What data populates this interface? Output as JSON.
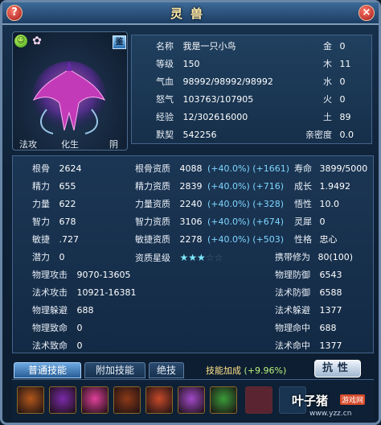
{
  "window": {
    "title": "灵兽",
    "help_label": "?",
    "close_label": "×"
  },
  "portrait": {
    "appraise_label": "鉴",
    "labels": [
      "法攻",
      "化生",
      "阴"
    ]
  },
  "identity": {
    "rows": [
      {
        "key": "名称",
        "value": "我是一只小鸟"
      },
      {
        "key": "等级",
        "value": "150"
      },
      {
        "key": "气血",
        "value": "98992/98992/98992"
      },
      {
        "key": "怒气",
        "value": "103763/107905"
      },
      {
        "key": "经验",
        "value": "12/302616000"
      },
      {
        "key": "默契",
        "value": "542256"
      }
    ],
    "elements": [
      {
        "key": "金",
        "value": "0"
      },
      {
        "key": "木",
        "value": "11"
      },
      {
        "key": "水",
        "value": "0"
      },
      {
        "key": "火",
        "value": "0"
      },
      {
        "key": "土",
        "value": "89"
      },
      {
        "key": "亲密度",
        "value": "0.0"
      }
    ]
  },
  "attributes": {
    "base": [
      {
        "key": "根骨",
        "value": "2624"
      },
      {
        "key": "精力",
        "value": "655"
      },
      {
        "key": "力量",
        "value": "622"
      },
      {
        "key": "智力",
        "value": "678"
      },
      {
        "key": "敏捷",
        "value": ".727"
      },
      {
        "key": "潜力",
        "value": "0"
      }
    ],
    "aptitude": [
      {
        "key": "根骨资质",
        "value": "4088",
        "bonus": "(+40.0%) (+1661)"
      },
      {
        "key": "精力资质",
        "value": "2839",
        "bonus": "(+40.0%) (+716)"
      },
      {
        "key": "力量资质",
        "value": "2240",
        "bonus": "(+40.0%) (+328)"
      },
      {
        "key": "智力资质",
        "value": "3106",
        "bonus": "(+40.0%) (+674)"
      },
      {
        "key": "敏捷资质",
        "value": "2278",
        "bonus": "(+40.0%) (+503)"
      }
    ],
    "star_label": "资质星级",
    "stars_filled": 3,
    "stars_total": 5,
    "right": [
      {
        "key": "寿命",
        "value": "3899/5000"
      },
      {
        "key": "成长",
        "value": "1.9492"
      },
      {
        "key": "悟性",
        "value": "10.0"
      },
      {
        "key": "灵犀",
        "value": "0"
      },
      {
        "key": "性格",
        "value": "忠心"
      },
      {
        "key": "携带修为",
        "value": "80(100)"
      }
    ],
    "combat_left": [
      {
        "key": "物理攻击",
        "value": "9070-13605"
      },
      {
        "key": "法术攻击",
        "value": "10921-16381"
      },
      {
        "key": "物理躲避",
        "value": "688"
      },
      {
        "key": "物理致命",
        "value": "0"
      },
      {
        "key": "法术致命",
        "value": "0"
      }
    ],
    "combat_right": [
      {
        "key": "物理防御",
        "value": "6543"
      },
      {
        "key": "法术防御",
        "value": "6588"
      },
      {
        "key": "法术躲避",
        "value": "1377"
      },
      {
        "key": "物理命中",
        "value": "688"
      },
      {
        "key": "法术命中",
        "value": "1377"
      }
    ]
  },
  "tabs": [
    {
      "label": "普通技能",
      "active": true
    },
    {
      "label": "附加技能",
      "active": false
    },
    {
      "label": "绝技",
      "active": false
    }
  ],
  "skill_bonus": {
    "label": "技能加成",
    "value": "(+9.96%)"
  },
  "awaken_label": "抗性",
  "watermark": {
    "name": "叶子猪",
    "tag": "游戏网",
    "url": "www.yzz.cn"
  },
  "skill_colors": [
    "#b0571b",
    "#7a2aa8",
    "#e0409a",
    "#8c3a18",
    "#c64a2a",
    "#a04ac8",
    "#3a9a3a",
    "#6a2ab0"
  ]
}
